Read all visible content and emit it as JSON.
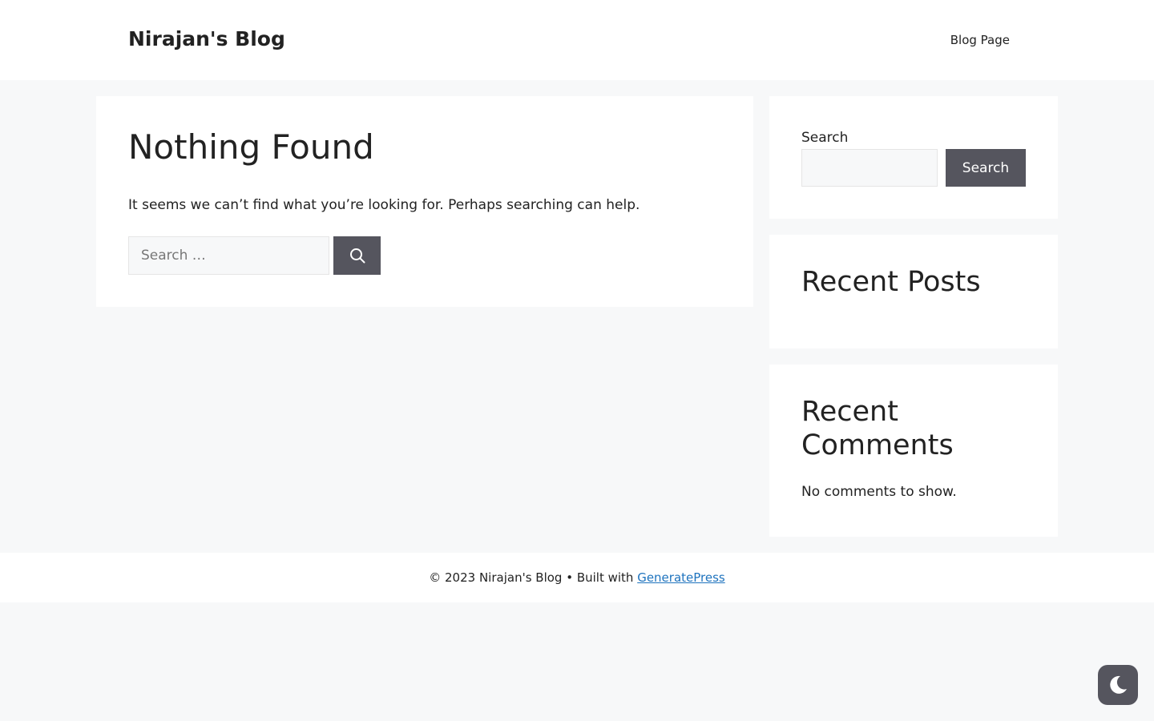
{
  "header": {
    "site_title": "Nirajan's Blog",
    "nav": [
      {
        "label": "Blog Page"
      }
    ]
  },
  "main": {
    "title": "Nothing Found",
    "text": "It seems we can’t find what you’re looking for. Perhaps searching can help.",
    "search": {
      "placeholder": "Search …",
      "value": "",
      "button_icon": "search-icon"
    }
  },
  "sidebar": {
    "search_widget": {
      "label": "Search",
      "value": "",
      "button_label": "Search"
    },
    "recent_posts": {
      "title": "Recent Posts"
    },
    "recent_comments": {
      "title": "Recent Comments",
      "text": "No comments to show."
    }
  },
  "footer": {
    "prefix": "© 2023 Nirajan's Blog • Built with ",
    "link_label": "GeneratePress"
  },
  "dark_mode_toggle": {
    "icon": "moon-icon"
  },
  "colors": {
    "background": "#f7f8f9",
    "card": "#ffffff",
    "button": "#55555e",
    "link": "#1e73be",
    "text": "#222222"
  }
}
